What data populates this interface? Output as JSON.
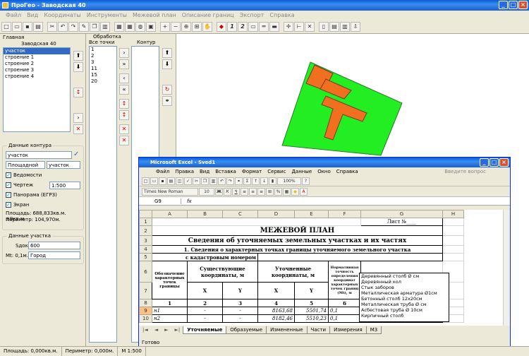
{
  "app": {
    "title": "ПроГео - Заводская 40",
    "menu": [
      "Файл",
      "Вид",
      "Координаты",
      "Инструменты",
      "Межевой план",
      "Описание границ",
      "Экспорт",
      "Справка"
    ]
  },
  "left_panel": {
    "header": "Главная",
    "object_name": "Заводская 40",
    "items": [
      "участок",
      "строение 1",
      "строение 2",
      "строение 3",
      "строение 4"
    ],
    "contour_group_title": "Данные контура",
    "contour_name": "участок",
    "area_mode": "Площадной",
    "type": "участок",
    "checks": [
      "Ведомости",
      "Чертеж",
      "Панорама (ЕГРЗ)",
      "Экран"
    ],
    "scale": "1:500",
    "area_text": "Площадь: 688,833кв.м. ±9кв.м.",
    "perimeter_text": "Периметр: 104,970м.",
    "parcel_group_title": "Данные участка",
    "sdok_label": "Sдок",
    "sdok_value": "600",
    "mt_label": "Mt: 0,1м.",
    "category": "Город"
  },
  "mid_panel": {
    "header": "Обработка",
    "col1": "Все точки",
    "col2": "Контур",
    "points": [
      "1",
      "2",
      "3",
      "11",
      "15",
      "20"
    ]
  },
  "excel": {
    "title": "Microsoft Excel - Sved1",
    "menu": [
      "Файл",
      "Правка",
      "Вид",
      "Вставка",
      "Формат",
      "Сервис",
      "Данные",
      "Окно",
      "Справка"
    ],
    "help_placeholder": "Введите вопрос",
    "font": "Times New Roman",
    "font_size": "10",
    "zoom": "100%",
    "cell_ref": "G9",
    "columns": [
      "A",
      "B",
      "C",
      "D",
      "E",
      "F",
      "G",
      "H"
    ],
    "sheet_label": "Лист №____",
    "heading1": "МЕЖЕВОЙ ПЛАН",
    "heading2": "Сведения об уточняемых земельных участках и их частях",
    "heading3": "1. Сведения о характерных точках границы уточняемого земельного участка",
    "heading3b": "с кадастровым номером",
    "col_point": "Обозначение характерных точек границы",
    "col_existing": "Существующие координаты, м",
    "col_refined": "Уточненные координаты, м",
    "col_accuracy": "Нормативная точность определения координат характерных точек границ (Mt), м",
    "x_label": "X",
    "y_label": "Y",
    "numbers": [
      "1",
      "2",
      "3",
      "4",
      "5",
      "6"
    ],
    "rows": [
      {
        "num": "9",
        "point": "н1",
        "ex": "-",
        "ey": "-",
        "x": "8163,68",
        "y": "5501,74",
        "mt": "0,1"
      },
      {
        "num": "10",
        "point": "н2",
        "ex": "-",
        "ey": "-",
        "x": "8182,46",
        "y": "5510,23",
        "mt": "0,1"
      }
    ],
    "dropdown_options": [
      "Деревянный столб Ø см",
      "Деревянный кол",
      "Стык заборов",
      "Металлическая арматура Ø1см",
      "Бетонный столб 12х20см",
      "Металлическая труба Ø см",
      "Асбестовая труба Ø 10см",
      "Кирпичный столб"
    ],
    "tabs": [
      "Уточняемые",
      "Образуемые",
      "Измененные",
      "Части",
      "Измерения",
      "М3"
    ],
    "status": "Готово"
  },
  "statusbar": {
    "area": "Площадь: 0,000кв.м.",
    "perimeter": "Периметр: 0,000м.",
    "scale": "М 1:500"
  }
}
